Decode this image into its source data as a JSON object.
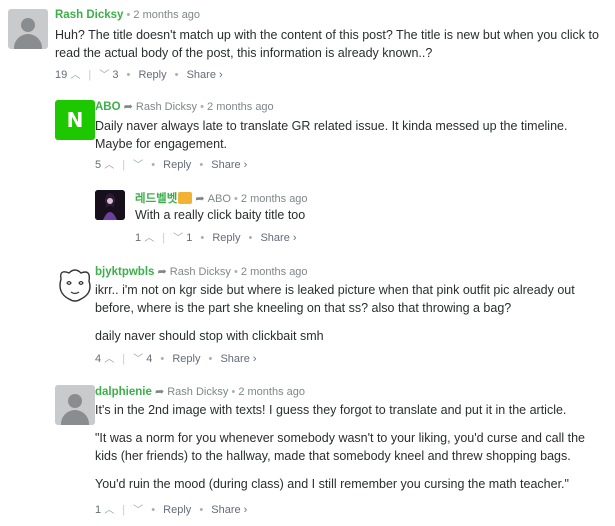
{
  "comments": [
    {
      "author": "Rash Dicksy",
      "reply_to": "",
      "time": "2 months ago",
      "body": [
        "Huh? The title doesn't match up with the content of this post? The title is new but when you click to read the actual body of the post, this information is already known..?"
      ],
      "upvotes": "19",
      "downvotes": "3",
      "reply_label": "Reply",
      "share_label": "Share ›",
      "avatar": "gray-user-icon"
    },
    {
      "author": "ABO",
      "reply_to": "Rash Dicksy",
      "time": "2 months ago",
      "body": [
        "Daily naver always late to translate GR related issue. It kinda messed up the timeline. Maybe for engagement."
      ],
      "upvotes": "5",
      "downvotes": "",
      "reply_label": "Reply",
      "share_label": "Share ›",
      "avatar": "naver-logo-icon",
      "avatar_letter": "N"
    },
    {
      "author": "레드벨벳",
      "reply_to": "ABO",
      "time": "2 months ago",
      "body": [
        "With a really click baity title too"
      ],
      "upvotes": "1",
      "downvotes": "1",
      "reply_label": "Reply",
      "share_label": "Share ›",
      "avatar": "portrait-art-icon"
    },
    {
      "author": "bjyktpwbls",
      "reply_to": "Rash Dicksy",
      "time": "2 months ago",
      "body": [
        "ikrr.. i'm not on kgr side but where is leaked picture when that pink outfit pic already out before, where is the part she kneeling on that ss? also that throwing a bag?",
        "daily naver should stop with clickbait smh"
      ],
      "upvotes": "4",
      "downvotes": "4",
      "reply_label": "Reply",
      "share_label": "Share ›",
      "avatar": "doodle-face-icon"
    },
    {
      "author": "dalphienie",
      "reply_to": "Rash Dicksy",
      "time": "2 months ago",
      "body": [
        "It's in the 2nd image with texts! I guess they forgot to translate and put it in the article.",
        "\"It was a norm for you whenever somebody wasn't to your liking, you'd curse and call the kids (her friends) to the hallway, made that somebody kneel and threw shopping bags.",
        "You'd ruin the mood (during class) and I still remember you cursing the math teacher.\""
      ],
      "upvotes": "1",
      "downvotes": "",
      "reply_label": "Reply",
      "share_label": "Share ›",
      "avatar": "gray-user-icon"
    }
  ]
}
